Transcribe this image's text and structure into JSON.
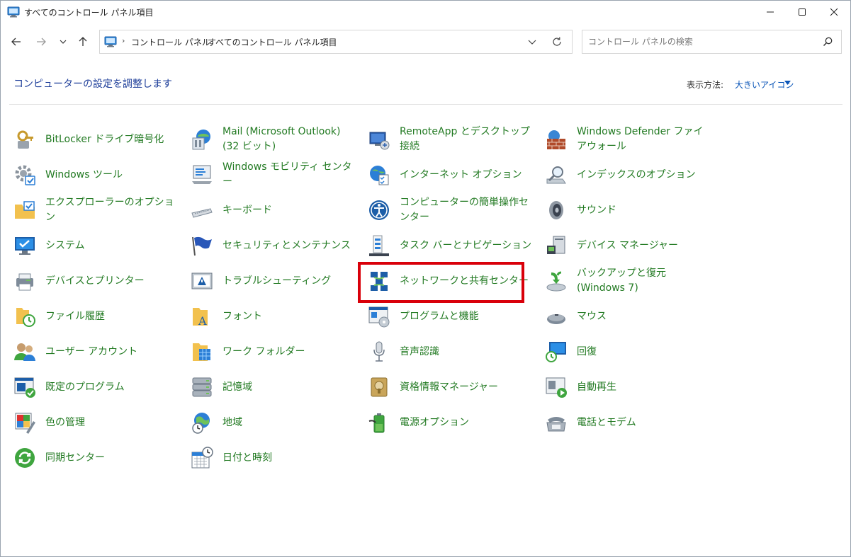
{
  "window": {
    "title": "すべてのコントロール パネル項目"
  },
  "nav": {
    "breadcrumb": [
      "コントロール パネル",
      "すべてのコントロール パネル項目"
    ],
    "search_placeholder": "コントロール パネルの検索"
  },
  "header": {
    "heading": "コンピューターの設定を調整します",
    "view_by_label": "表示方法:",
    "view_by_value": "大きいアイコン"
  },
  "colors": {
    "link_green": "#227a22",
    "heading_blue": "#1f3f9a",
    "highlight_red": "#d9000a"
  },
  "items": [
    {
      "label": "BitLocker ドライブ暗号化",
      "icon": "bitlocker-icon"
    },
    {
      "label": "Mail (Microsoft Outlook) (32 ビット)",
      "icon": "mail-icon"
    },
    {
      "label": "RemoteApp とデスクトップ接続",
      "icon": "remoteapp-icon"
    },
    {
      "label": "Windows Defender ファイアウォール",
      "icon": "firewall-icon"
    },
    {
      "label": "Windows ツール",
      "icon": "windows-tools-icon"
    },
    {
      "label": "Windows モビリティ センター",
      "icon": "mobility-center-icon"
    },
    {
      "label": "インターネット オプション",
      "icon": "internet-options-icon"
    },
    {
      "label": "インデックスのオプション",
      "icon": "indexing-options-icon"
    },
    {
      "label": "エクスプローラーのオプション",
      "icon": "explorer-options-icon"
    },
    {
      "label": "キーボード",
      "icon": "keyboard-icon"
    },
    {
      "label": "コンピューターの簡単操作センター",
      "icon": "ease-of-access-icon"
    },
    {
      "label": "サウンド",
      "icon": "sound-icon"
    },
    {
      "label": "システム",
      "icon": "system-icon"
    },
    {
      "label": "セキュリティとメンテナンス",
      "icon": "security-flag-icon"
    },
    {
      "label": "タスク バーとナビゲーション",
      "icon": "taskbar-icon"
    },
    {
      "label": "デバイス マネージャー",
      "icon": "device-manager-icon"
    },
    {
      "label": "デバイスとプリンター",
      "icon": "printer-icon"
    },
    {
      "label": "トラブルシューティング",
      "icon": "troubleshooting-icon"
    },
    {
      "label": "ネットワークと共有センター",
      "icon": "network-icon"
    },
    {
      "label": "バックアップと復元 (Windows 7)",
      "icon": "backup-icon"
    },
    {
      "label": "ファイル履歴",
      "icon": "file-history-icon"
    },
    {
      "label": "フォント",
      "icon": "fonts-icon"
    },
    {
      "label": "プログラムと機能",
      "icon": "programs-icon"
    },
    {
      "label": "マウス",
      "icon": "mouse-icon"
    },
    {
      "label": "ユーザー アカウント",
      "icon": "user-accounts-icon"
    },
    {
      "label": "ワーク フォルダー",
      "icon": "work-folders-icon"
    },
    {
      "label": "音声認識",
      "icon": "microphone-icon"
    },
    {
      "label": "回復",
      "icon": "recovery-icon"
    },
    {
      "label": "既定のプログラム",
      "icon": "default-programs-icon"
    },
    {
      "label": "記憶域",
      "icon": "storage-icon"
    },
    {
      "label": "資格情報マネージャー",
      "icon": "credential-manager-icon"
    },
    {
      "label": "自動再生",
      "icon": "autoplay-icon"
    },
    {
      "label": "色の管理",
      "icon": "color-management-icon"
    },
    {
      "label": "地域",
      "icon": "region-icon"
    },
    {
      "label": "電源オプション",
      "icon": "power-options-icon"
    },
    {
      "label": "電話とモデム",
      "icon": "phone-modem-icon"
    },
    {
      "label": "同期センター",
      "icon": "sync-center-icon"
    },
    {
      "label": "日付と時刻",
      "icon": "date-time-icon"
    }
  ]
}
